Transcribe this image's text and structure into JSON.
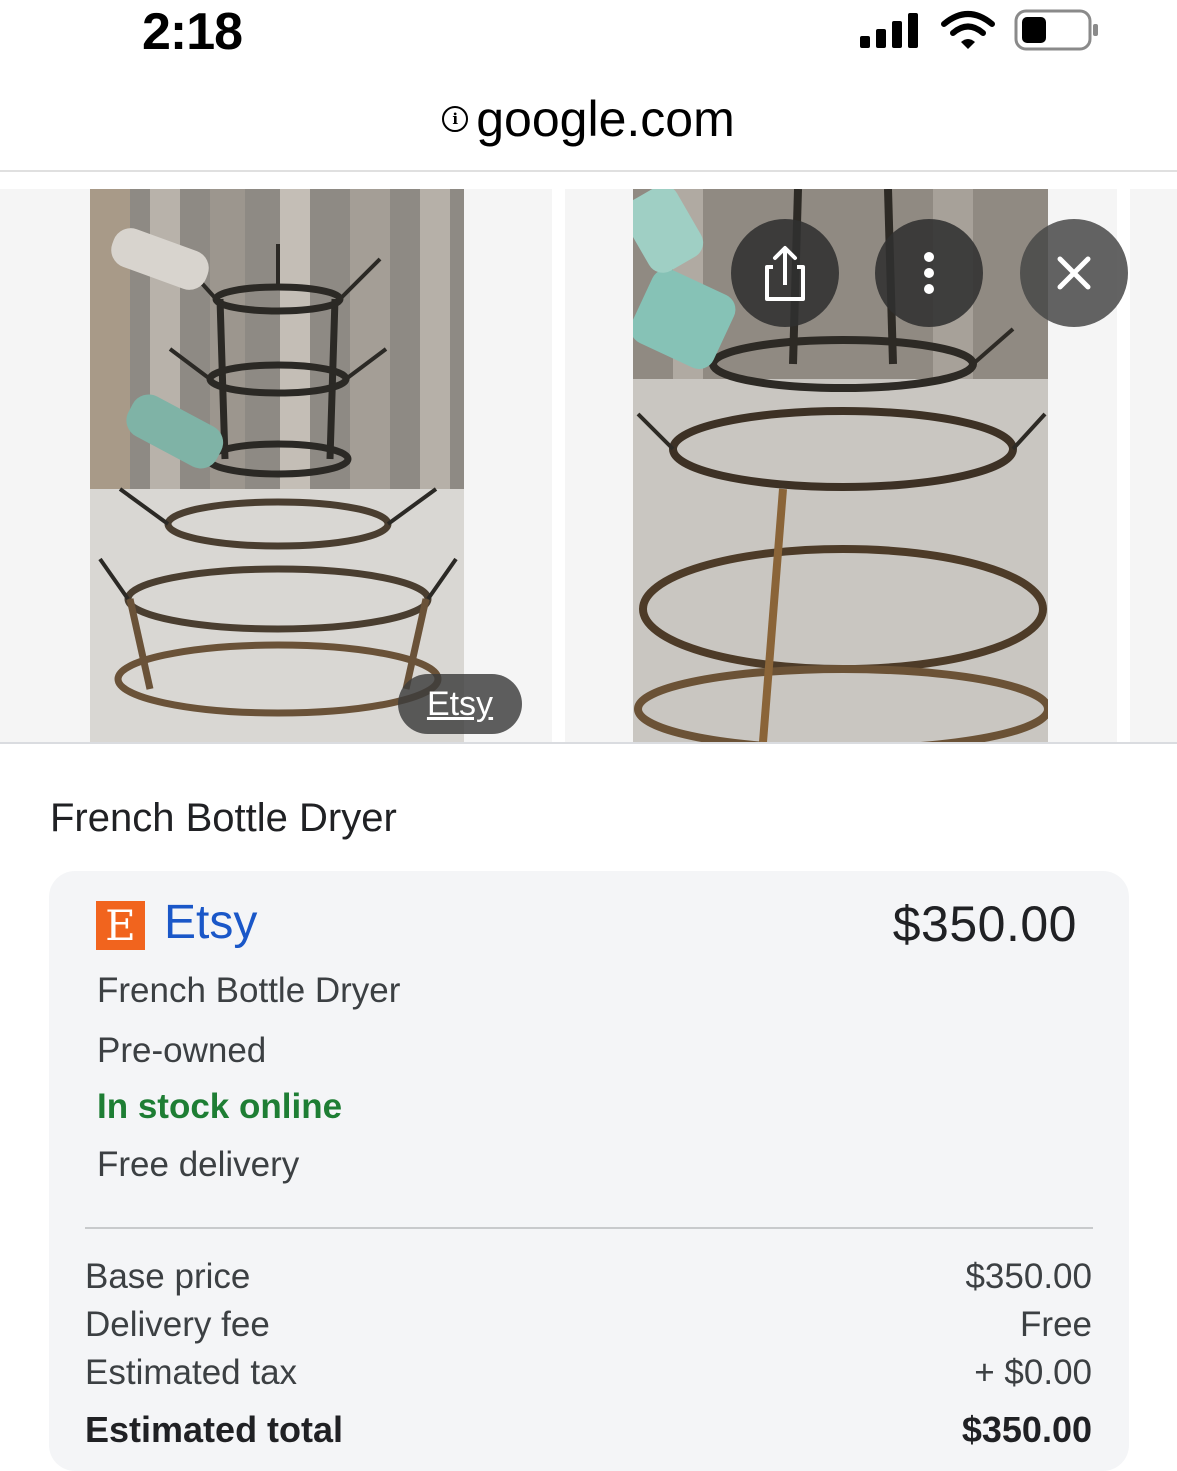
{
  "status_bar": {
    "time": "2:18"
  },
  "browser": {
    "url": "google.com"
  },
  "carousel": {
    "source_chip": "Etsy"
  },
  "product": {
    "title": "French Bottle Dryer"
  },
  "offer": {
    "merchant": "Etsy",
    "merchant_logo_letter": "E",
    "merchant_color": "#f1641e",
    "price": "$350.00",
    "name": "French Bottle Dryer",
    "condition": "Pre-owned",
    "stock": "In stock online",
    "stock_color": "#1e7e34",
    "delivery": "Free delivery"
  },
  "summary": {
    "base_price_label": "Base price",
    "base_price_value": "$350.00",
    "delivery_fee_label": "Delivery fee",
    "delivery_fee_value": "Free",
    "tax_label": "Estimated tax",
    "tax_value": "+ $0.00",
    "total_label": "Estimated total",
    "total_value": "$350.00"
  }
}
